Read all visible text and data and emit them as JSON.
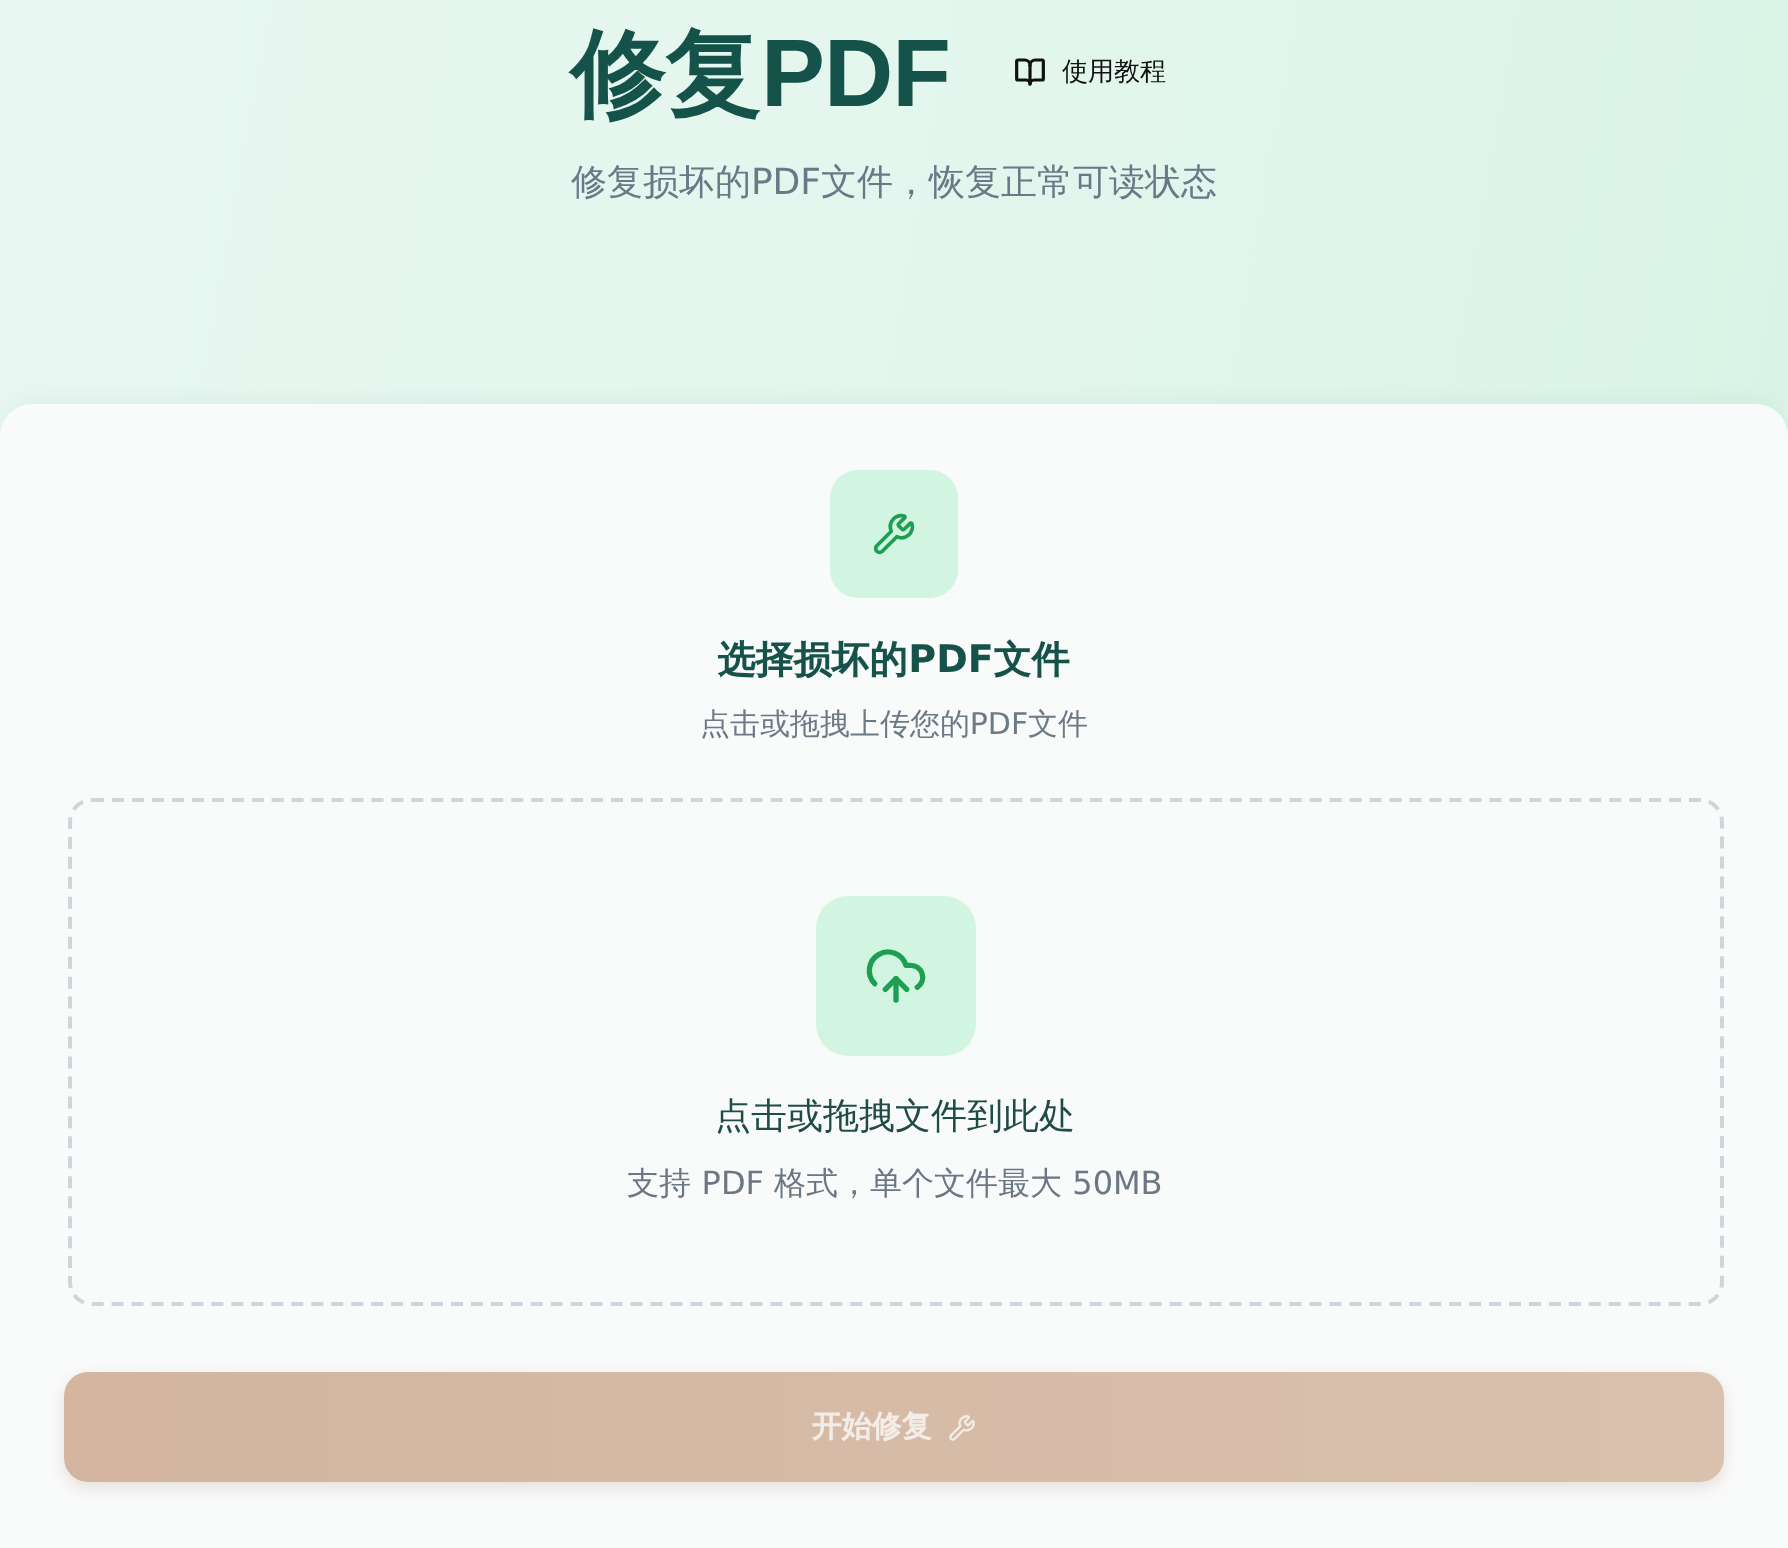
{
  "header": {
    "title": "修复PDF",
    "tutorial_link": "使用教程",
    "subtitle": "修复损坏的PDF文件，恢复正常可读状态"
  },
  "upload_card": {
    "heading": "选择损坏的PDF文件",
    "subheading": "点击或拖拽上传您的PDF文件",
    "dropzone": {
      "prompt": "点击或拖拽文件到此处",
      "hint": "支持 PDF 格式，单个文件最大 50MB"
    }
  },
  "action_button": {
    "label": "开始修复",
    "disabled": true
  }
}
